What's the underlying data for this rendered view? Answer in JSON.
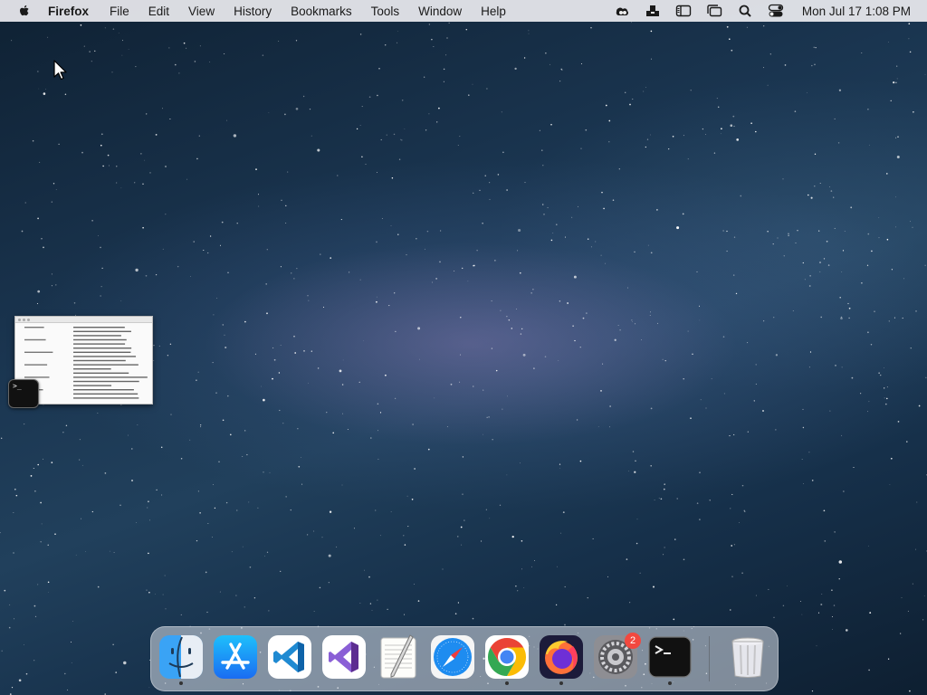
{
  "menubar": {
    "app_name": "Firefox",
    "items": [
      "File",
      "Edit",
      "View",
      "History",
      "Bookmarks",
      "Tools",
      "Window",
      "Help"
    ],
    "status_icons": [
      "creative-cloud-icon",
      "inbox-tray-icon",
      "sidebar-icon",
      "stage-manager-icon",
      "search-icon",
      "control-center-icon"
    ],
    "clock": "Mon Jul 17  1:08 PM"
  },
  "desktop": {
    "wallpaper": "starry-night-milky-way"
  },
  "thumbnail": {
    "app": "terminal",
    "prompt_glyph": ">_"
  },
  "dock": {
    "apps": [
      {
        "name": "Finder",
        "icon": "finder-icon",
        "running": true
      },
      {
        "name": "App Store",
        "icon": "app-store-icon",
        "running": false
      },
      {
        "name": "Visual Studio Code",
        "icon": "vscode-icon",
        "running": false
      },
      {
        "name": "Visual Studio",
        "icon": "visual-studio-icon",
        "running": false
      },
      {
        "name": "TextEdit",
        "icon": "textedit-icon",
        "running": false
      },
      {
        "name": "Safari",
        "icon": "safari-icon",
        "running": false
      },
      {
        "name": "Google Chrome",
        "icon": "chrome-icon",
        "running": true
      },
      {
        "name": "Firefox",
        "icon": "firefox-icon",
        "running": true
      },
      {
        "name": "System Settings",
        "icon": "system-settings-icon",
        "running": false,
        "badge": "2"
      },
      {
        "name": "Terminal",
        "icon": "terminal-icon",
        "running": true
      },
      {
        "name": "Trash",
        "icon": "trash-icon",
        "running": false
      }
    ]
  }
}
